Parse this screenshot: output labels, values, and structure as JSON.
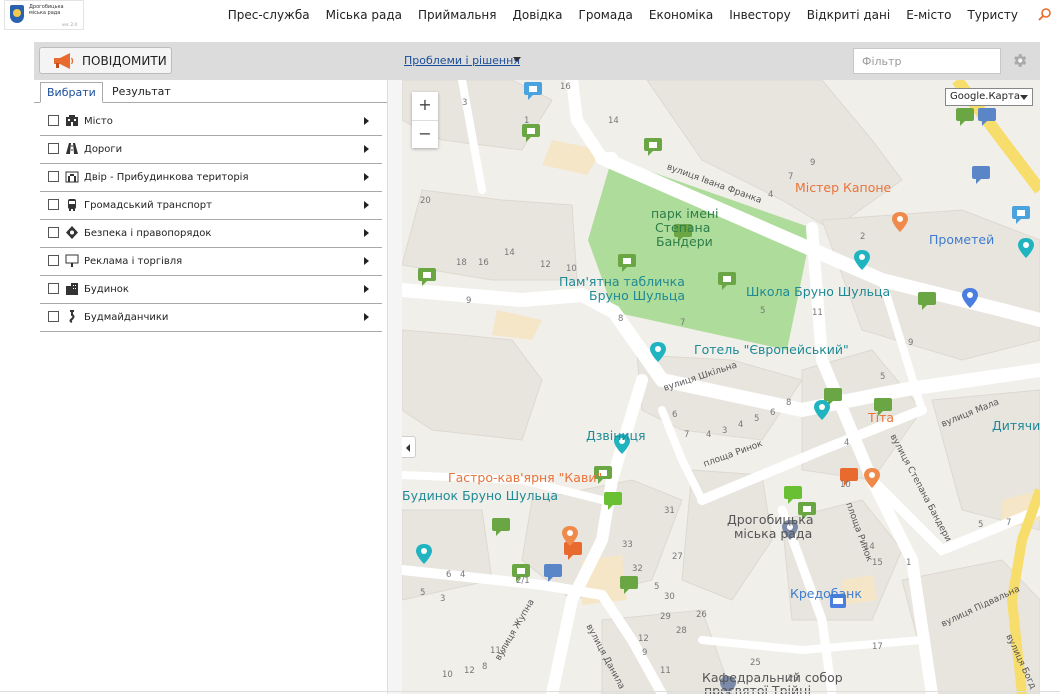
{
  "header": {
    "logo_text": "Дрогобицька міська рада",
    "logo_version": "ver. 2.0",
    "nav": [
      "Прес-служба",
      "Міська рада",
      "Приймальня",
      "Довідка",
      "Громада",
      "Економіка",
      "Інвестору",
      "Відкриті дані",
      "Е-місто",
      "Туристу"
    ]
  },
  "toolbar": {
    "report_label": "ПОВІДОМИТИ",
    "problems_link": "Проблеми і рішення",
    "filter_placeholder": "Фільтр"
  },
  "tabs": [
    "Вибрати",
    "Результат"
  ],
  "categories": [
    {
      "label": "Місто",
      "icon": "building-icon"
    },
    {
      "label": "Дороги",
      "icon": "road-icon"
    },
    {
      "label": "Двір - Прибудинкова територія",
      "icon": "yard-icon"
    },
    {
      "label": "Громадський транспорт",
      "icon": "bus-icon"
    },
    {
      "label": "Безпека і правопорядок",
      "icon": "safety-icon"
    },
    {
      "label": "Реклама і торгівля",
      "icon": "billboard-icon"
    },
    {
      "label": "Будинок",
      "icon": "house-icon"
    },
    {
      "label": "Будмайданчики",
      "icon": "crane-icon"
    }
  ],
  "map": {
    "map_type": "Google.Карта",
    "zoom_in": "+",
    "zoom_out": "−",
    "labels": {
      "park": "парк імені Степана Бандери",
      "park_l1": "парк імені",
      "park_l2": "Степана",
      "park_l3": "Бандери",
      "plaque_l1": "Пам'ятна табличка",
      "plaque_l2": "Бруно Шульца",
      "school": "Школа Бруно Шульца",
      "hotel": "Готель \"Європейський\"",
      "bell": "Дзвіниця",
      "cafe": "Гастро-кав'ярня \"Кави\"",
      "house": "Будинок Бруно Шульца",
      "council_l1": "Дрогобицька",
      "council_l2": "міська рада",
      "bank": "Кредобанк",
      "cathedral_l1": "Кафедральний собор",
      "cathedral_l2": "пресвятої Трійці",
      "capone": "Містер Капоне",
      "prometey": "Прометей",
      "tita": "Тіта",
      "kids": "Дитячи"
    },
    "streets": {
      "franka": "вулиця Івана Франка",
      "shkilna": "вулиця Шкільна",
      "rynok": "площа Ринок",
      "rynok2": "площа Ринок",
      "bandery": "вулиця Степана Бандери",
      "mala": "вулиця Мала",
      "pidvalna": "вулиця Підвальна",
      "zhupna": "вулиця Жупна",
      "danyla": "вулиця Данила",
      "bohd": "вулиця Богд"
    },
    "numbers": [
      "16",
      "3",
      "1",
      "14",
      "9",
      "7",
      "4",
      "2",
      "20",
      "18",
      "16",
      "14",
      "12",
      "10",
      "9",
      "8",
      "7",
      "5",
      "11",
      "9",
      "8",
      "6",
      "5",
      "4",
      "3",
      "4",
      "7",
      "6",
      "5",
      "4",
      "10",
      "31",
      "33",
      "27",
      "32",
      "5",
      "30",
      "26",
      "29",
      "28",
      "12",
      "11",
      "9",
      "6",
      "4",
      "2/1",
      "5",
      "3",
      "11а",
      "10",
      "8",
      "12",
      "14",
      "15",
      "1",
      "17",
      "25",
      "23",
      "5",
      "7"
    ]
  },
  "colors": {
    "accent_blue": "#1a4d99",
    "park_green": "#aedc9a",
    "marker_green": "#6aa644",
    "marker_orange": "#e96a2e",
    "marker_blue": "#5a86c7",
    "road_yellow": "#f7dd6b"
  }
}
